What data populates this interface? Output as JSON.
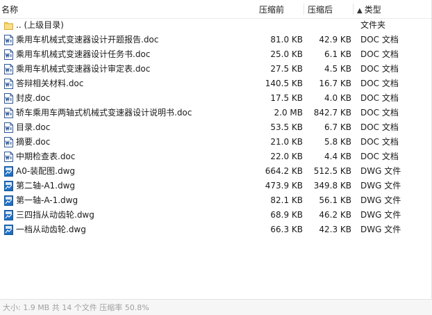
{
  "header": {
    "name": "名称",
    "original_size": "压缩前",
    "compressed_size": "压缩后",
    "type": "类型",
    "sort_indicator": "▲"
  },
  "colors": {
    "doc_icon": "#2b579a",
    "dwg_icon": "#1e6fc4",
    "folder_icon": "#f6cf57",
    "status_text": "#a0a0a0"
  },
  "rows": [
    {
      "icon": "folder-up-icon",
      "name": ".. (上级目录)",
      "orig": "",
      "comp": "",
      "type": "文件夹"
    },
    {
      "icon": "word-doc-icon",
      "name": "乘用车机械式变速器设计开题报告.doc",
      "orig": "81.0 KB",
      "comp": "42.9 KB",
      "type": "DOC 文档"
    },
    {
      "icon": "word-doc-icon",
      "name": "乘用车机械式变速器设计任务书.doc",
      "orig": "25.0 KB",
      "comp": "6.1 KB",
      "type": "DOC 文档"
    },
    {
      "icon": "word-doc-icon",
      "name": "乘用车机械式变速器设计审定表.doc",
      "orig": "27.5 KB",
      "comp": "4.5 KB",
      "type": "DOC 文档"
    },
    {
      "icon": "word-doc-icon",
      "name": "答辩相关材料.doc",
      "orig": "140.5 KB",
      "comp": "16.7 KB",
      "type": "DOC 文档"
    },
    {
      "icon": "word-doc-icon",
      "name": "封皮.doc",
      "orig": "17.5 KB",
      "comp": "4.0 KB",
      "type": "DOC 文档"
    },
    {
      "icon": "word-doc-icon",
      "name": "轿车乘用车两轴式机械式变速器设计说明书.doc",
      "orig": "2.0 MB",
      "comp": "842.7 KB",
      "type": "DOC 文档"
    },
    {
      "icon": "word-doc-icon",
      "name": "目录.doc",
      "orig": "53.5 KB",
      "comp": "6.7 KB",
      "type": "DOC 文档"
    },
    {
      "icon": "word-doc-icon",
      "name": "摘要.doc",
      "orig": "21.0 KB",
      "comp": "5.8 KB",
      "type": "DOC 文档"
    },
    {
      "icon": "word-doc-icon",
      "name": "中期检查表.doc",
      "orig": "22.0 KB",
      "comp": "4.4 KB",
      "type": "DOC 文档"
    },
    {
      "icon": "dwg-file-icon",
      "name": "A0-装配图.dwg",
      "orig": "664.2 KB",
      "comp": "512.5 KB",
      "type": "DWG 文件"
    },
    {
      "icon": "dwg-file-icon",
      "name": "第二轴-A1.dwg",
      "orig": "473.9 KB",
      "comp": "349.8 KB",
      "type": "DWG 文件"
    },
    {
      "icon": "dwg-file-icon",
      "name": "第一轴-A-1.dwg",
      "orig": "82.1 KB",
      "comp": "56.1 KB",
      "type": "DWG 文件"
    },
    {
      "icon": "dwg-file-icon",
      "name": "三四挡从动齿轮.dwg",
      "orig": "68.9 KB",
      "comp": "46.2 KB",
      "type": "DWG 文件"
    },
    {
      "icon": "dwg-file-icon",
      "name": "一档从动齿轮.dwg",
      "orig": "66.3 KB",
      "comp": "42.3 KB",
      "type": "DWG 文件"
    }
  ],
  "status": {
    "text": "大小: 1.9 MB 共 14 个文件 压缩率 50.8%"
  }
}
